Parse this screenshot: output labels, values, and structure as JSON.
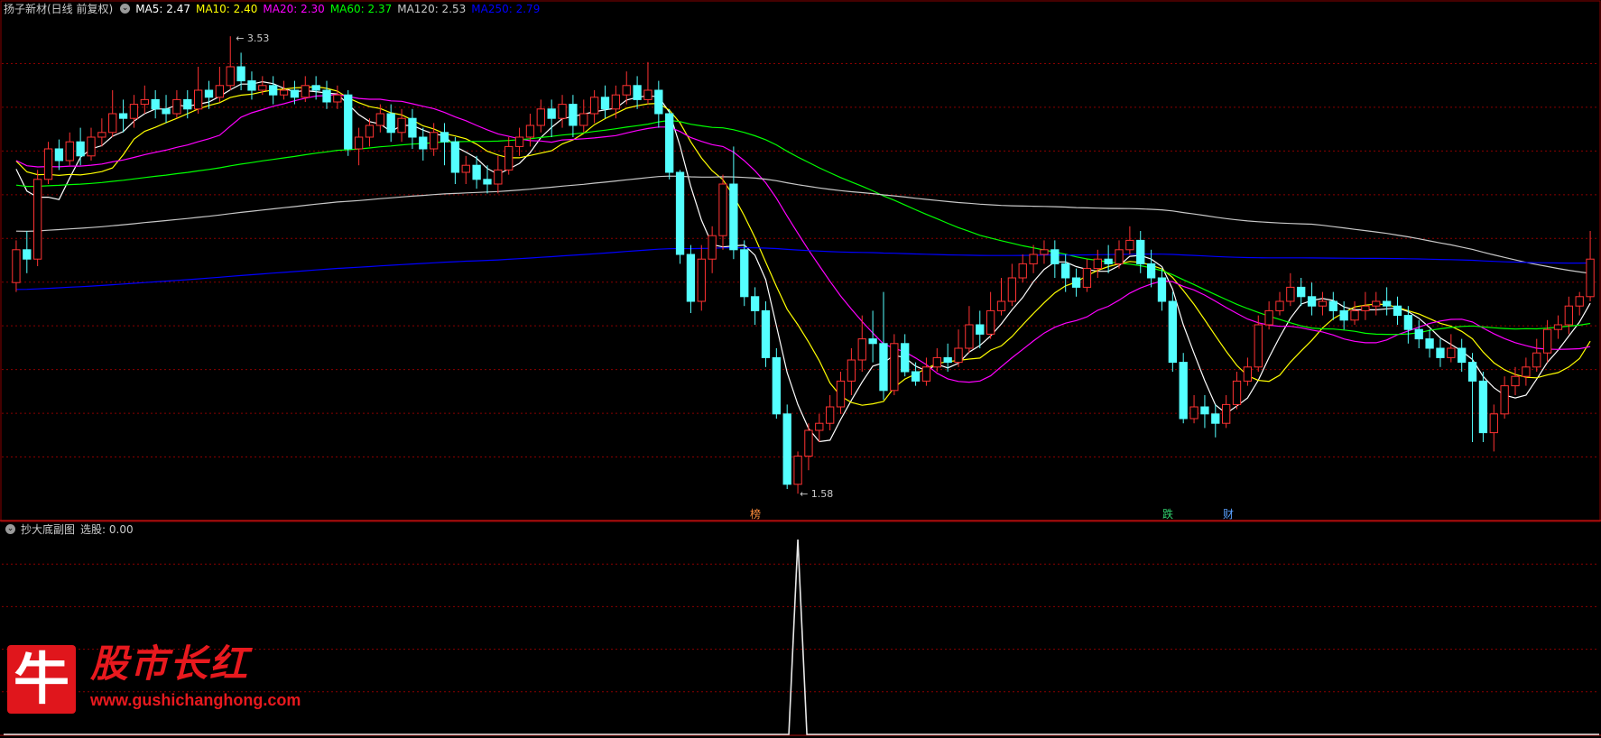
{
  "main_panel": {
    "stock_name": "扬子新材(日线 前复权)",
    "indicators": [
      {
        "label": "MA5: 2.47",
        "color": "#ffffff"
      },
      {
        "label": "MA10: 2.40",
        "color": "#ffff00"
      },
      {
        "label": "MA20: 2.30",
        "color": "#ff00ff"
      },
      {
        "label": "MA60: 2.37",
        "color": "#00ff00"
      },
      {
        "label": "MA120: 2.53",
        "color": "#c8c8c8"
      },
      {
        "label": "MA250: 2.79",
        "color": "#0000ff"
      }
    ],
    "signals": [
      {
        "text": "榜",
        "color": "#ff8c3c"
      },
      {
        "text": "跌",
        "color": "#32d26e"
      },
      {
        "text": "财",
        "color": "#5aa0ff"
      }
    ]
  },
  "sub_panel": {
    "title": "抄大底副图",
    "value_label": "选股: 0.00"
  },
  "logo": {
    "char": "牛",
    "name": "股市长红",
    "url": "www.gushichanghong.com"
  },
  "chart_data": {
    "type": "candlestick",
    "high_label": "3.53",
    "low_label": "1.58",
    "price_range": [
      1.55,
      3.6
    ],
    "colors": {
      "up": "#ff3232",
      "down": "#54ffff",
      "grid": "#8a0000"
    },
    "candles": [
      [
        2.48,
        2.62,
        2.66,
        2.44
      ],
      [
        2.62,
        2.58,
        2.7,
        2.52
      ],
      [
        2.58,
        2.92,
        2.96,
        2.55
      ],
      [
        2.92,
        3.05,
        3.08,
        2.9
      ],
      [
        3.05,
        3.0,
        3.09,
        2.96
      ],
      [
        3.0,
        3.08,
        3.12,
        2.98
      ],
      [
        3.08,
        3.02,
        3.14,
        2.98
      ],
      [
        3.02,
        3.1,
        3.14,
        3.0
      ],
      [
        3.1,
        3.12,
        3.18,
        3.06
      ],
      [
        3.12,
        3.2,
        3.3,
        3.1
      ],
      [
        3.2,
        3.18,
        3.26,
        3.12
      ],
      [
        3.18,
        3.24,
        3.28,
        3.14
      ],
      [
        3.24,
        3.26,
        3.32,
        3.2
      ],
      [
        3.26,
        3.22,
        3.3,
        3.18
      ],
      [
        3.22,
        3.2,
        3.28,
        3.16
      ],
      [
        3.2,
        3.26,
        3.3,
        3.18
      ],
      [
        3.26,
        3.22,
        3.3,
        3.18
      ],
      [
        3.22,
        3.3,
        3.4,
        3.2
      ],
      [
        3.3,
        3.27,
        3.34,
        3.22
      ],
      [
        3.27,
        3.32,
        3.4,
        3.25
      ],
      [
        3.32,
        3.4,
        3.53,
        3.3
      ],
      [
        3.4,
        3.34,
        3.46,
        3.3
      ],
      [
        3.34,
        3.3,
        3.38,
        3.26
      ],
      [
        3.3,
        3.32,
        3.36,
        3.28
      ],
      [
        3.32,
        3.28,
        3.36,
        3.24
      ],
      [
        3.28,
        3.3,
        3.34,
        3.26
      ],
      [
        3.3,
        3.27,
        3.34,
        3.24
      ],
      [
        3.27,
        3.32,
        3.36,
        3.25
      ],
      [
        3.32,
        3.3,
        3.36,
        3.26
      ],
      [
        3.3,
        3.25,
        3.34,
        3.22
      ],
      [
        3.25,
        3.28,
        3.32,
        3.22
      ],
      [
        3.28,
        3.05,
        3.3,
        3.02
      ],
      [
        3.05,
        3.1,
        3.14,
        2.98
      ],
      [
        3.1,
        3.15,
        3.18,
        3.06
      ],
      [
        3.15,
        3.2,
        3.24,
        3.12
      ],
      [
        3.2,
        3.12,
        3.24,
        3.08
      ],
      [
        3.12,
        3.18,
        3.22,
        3.08
      ],
      [
        3.18,
        3.1,
        3.22,
        3.05
      ],
      [
        3.1,
        3.05,
        3.14,
        3.0
      ],
      [
        3.05,
        3.12,
        3.16,
        3.02
      ],
      [
        3.12,
        3.08,
        3.16,
        2.98
      ],
      [
        3.08,
        2.95,
        3.1,
        2.9
      ],
      [
        2.95,
        2.98,
        3.02,
        2.9
      ],
      [
        2.98,
        2.92,
        3.02,
        2.88
      ],
      [
        2.92,
        2.9,
        2.98,
        2.86
      ],
      [
        2.9,
        2.96,
        3.02,
        2.86
      ],
      [
        2.96,
        3.06,
        3.1,
        2.94
      ],
      [
        3.06,
        3.1,
        3.14,
        3.02
      ],
      [
        3.1,
        3.15,
        3.2,
        3.06
      ],
      [
        3.15,
        3.22,
        3.26,
        3.12
      ],
      [
        3.22,
        3.18,
        3.26,
        3.1
      ],
      [
        3.18,
        3.24,
        3.28,
        3.14
      ],
      [
        3.24,
        3.15,
        3.28,
        3.1
      ],
      [
        3.15,
        3.2,
        3.26,
        3.12
      ],
      [
        3.2,
        3.27,
        3.3,
        3.16
      ],
      [
        3.27,
        3.22,
        3.32,
        3.18
      ],
      [
        3.22,
        3.28,
        3.32,
        3.18
      ],
      [
        3.28,
        3.32,
        3.38,
        3.24
      ],
      [
        3.32,
        3.26,
        3.36,
        3.22
      ],
      [
        3.26,
        3.3,
        3.42,
        3.24
      ],
      [
        3.3,
        3.2,
        3.34,
        3.14
      ],
      [
        3.2,
        2.95,
        3.22,
        2.92
      ],
      [
        2.95,
        2.6,
        2.96,
        2.56
      ],
      [
        2.6,
        2.4,
        2.64,
        2.35
      ],
      [
        2.4,
        2.58,
        2.64,
        2.36
      ],
      [
        2.58,
        2.68,
        2.72,
        2.52
      ],
      [
        2.68,
        2.9,
        2.94,
        2.62
      ],
      [
        2.9,
        2.62,
        3.06,
        2.58
      ],
      [
        2.62,
        2.42,
        2.66,
        2.38
      ],
      [
        2.42,
        2.36,
        2.46,
        2.3
      ],
      [
        2.36,
        2.16,
        2.4,
        2.12
      ],
      [
        2.16,
        1.92,
        2.2,
        1.9
      ],
      [
        1.92,
        1.62,
        1.96,
        1.6
      ],
      [
        1.62,
        1.74,
        1.76,
        1.58
      ],
      [
        1.74,
        1.85,
        1.88,
        1.68
      ],
      [
        1.85,
        1.88,
        1.92,
        1.8
      ],
      [
        1.88,
        1.95,
        2.0,
        1.85
      ],
      [
        1.95,
        2.06,
        2.1,
        1.92
      ],
      [
        2.06,
        2.15,
        2.2,
        2.0
      ],
      [
        2.15,
        2.24,
        2.34,
        2.1
      ],
      [
        2.24,
        2.22,
        2.36,
        2.14
      ],
      [
        2.22,
        2.02,
        2.44,
        1.98
      ],
      [
        2.02,
        2.22,
        2.26,
        2.0
      ],
      [
        2.22,
        2.1,
        2.26,
        2.08
      ],
      [
        2.1,
        2.06,
        2.14,
        2.04
      ],
      [
        2.06,
        2.12,
        2.16,
        2.04
      ],
      [
        2.12,
        2.16,
        2.2,
        2.1
      ],
      [
        2.16,
        2.14,
        2.22,
        2.1
      ],
      [
        2.14,
        2.2,
        2.28,
        2.12
      ],
      [
        2.2,
        2.3,
        2.38,
        2.18
      ],
      [
        2.3,
        2.26,
        2.36,
        2.2
      ],
      [
        2.26,
        2.36,
        2.44,
        2.24
      ],
      [
        2.36,
        2.4,
        2.5,
        2.34
      ],
      [
        2.4,
        2.5,
        2.56,
        2.38
      ],
      [
        2.5,
        2.56,
        2.6,
        2.48
      ],
      [
        2.56,
        2.6,
        2.64,
        2.52
      ],
      [
        2.6,
        2.62,
        2.66,
        2.56
      ],
      [
        2.62,
        2.56,
        2.66,
        2.5
      ],
      [
        2.56,
        2.5,
        2.6,
        2.44
      ],
      [
        2.5,
        2.46,
        2.54,
        2.42
      ],
      [
        2.46,
        2.54,
        2.58,
        2.44
      ],
      [
        2.54,
        2.58,
        2.62,
        2.5
      ],
      [
        2.58,
        2.56,
        2.64,
        2.52
      ],
      [
        2.56,
        2.62,
        2.66,
        2.54
      ],
      [
        2.62,
        2.66,
        2.72,
        2.6
      ],
      [
        2.66,
        2.56,
        2.7,
        2.52
      ],
      [
        2.56,
        2.5,
        2.62,
        2.46
      ],
      [
        2.5,
        2.4,
        2.54,
        2.36
      ],
      [
        2.4,
        2.14,
        2.44,
        2.1
      ],
      [
        2.14,
        1.9,
        2.18,
        1.88
      ],
      [
        1.9,
        1.95,
        2.0,
        1.88
      ],
      [
        1.95,
        1.92,
        2.0,
        1.86
      ],
      [
        1.92,
        1.88,
        1.96,
        1.82
      ],
      [
        1.88,
        1.96,
        2.0,
        1.86
      ],
      [
        1.96,
        2.06,
        2.1,
        1.94
      ],
      [
        2.06,
        2.12,
        2.16,
        2.04
      ],
      [
        2.12,
        2.3,
        2.34,
        2.1
      ],
      [
        2.3,
        2.36,
        2.4,
        2.28
      ],
      [
        2.36,
        2.4,
        2.44,
        2.34
      ],
      [
        2.4,
        2.46,
        2.52,
        2.38
      ],
      [
        2.46,
        2.42,
        2.5,
        2.38
      ],
      [
        2.42,
        2.38,
        2.48,
        2.34
      ],
      [
        2.38,
        2.4,
        2.44,
        2.34
      ],
      [
        2.4,
        2.36,
        2.44,
        2.32
      ],
      [
        2.36,
        2.32,
        2.4,
        2.28
      ],
      [
        2.32,
        2.36,
        2.4,
        2.3
      ],
      [
        2.36,
        2.38,
        2.44,
        2.32
      ],
      [
        2.38,
        2.4,
        2.44,
        2.34
      ],
      [
        2.4,
        2.38,
        2.46,
        2.34
      ],
      [
        2.38,
        2.34,
        2.42,
        2.3
      ],
      [
        2.34,
        2.28,
        2.38,
        2.22
      ],
      [
        2.28,
        2.24,
        2.32,
        2.2
      ],
      [
        2.24,
        2.2,
        2.28,
        2.16
      ],
      [
        2.2,
        2.16,
        2.24,
        2.12
      ],
      [
        2.16,
        2.2,
        2.26,
        2.14
      ],
      [
        2.2,
        2.14,
        2.24,
        2.1
      ],
      [
        2.14,
        2.06,
        2.18,
        1.8
      ],
      [
        2.06,
        1.84,
        2.1,
        1.8
      ],
      [
        1.84,
        1.92,
        1.96,
        1.76
      ],
      [
        1.92,
        2.04,
        2.08,
        1.9
      ],
      [
        2.04,
        2.08,
        2.12,
        2.0
      ],
      [
        2.08,
        2.12,
        2.16,
        2.04
      ],
      [
        2.12,
        2.18,
        2.24,
        2.1
      ],
      [
        2.18,
        2.28,
        2.32,
        2.14
      ],
      [
        2.28,
        2.3,
        2.34,
        2.24
      ],
      [
        2.3,
        2.38,
        2.42,
        2.26
      ],
      [
        2.38,
        2.42,
        2.44,
        2.34
      ],
      [
        2.42,
        2.58,
        2.7,
        2.4
      ]
    ],
    "sub_panel_series": {
      "type": "line",
      "spike_index": 73,
      "values": [
        0,
        1
      ]
    }
  }
}
